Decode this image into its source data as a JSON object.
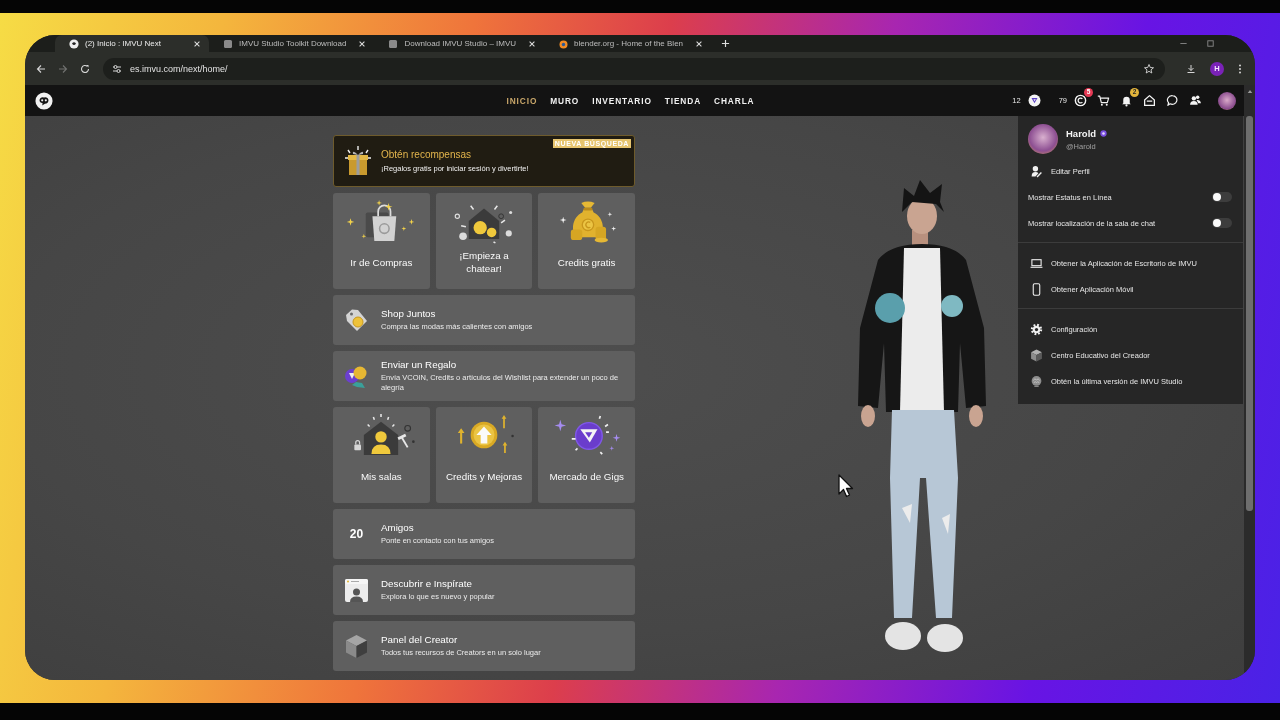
{
  "browser": {
    "tabs": [
      {
        "title": "(2) Inicio : IMVU Next",
        "selected": true
      },
      {
        "title": "IMVU Studio Toolkit Download",
        "selected": false
      },
      {
        "title": "Download IMVU Studio – IMVU",
        "selected": false
      },
      {
        "title": "blender.org - Home of the Blen",
        "selected": false
      }
    ],
    "forward_disabled": true,
    "url": "es.imvu.com/next/home/",
    "profile_initial": "H"
  },
  "nav": {
    "links": [
      {
        "label": "INICIO",
        "selected": true
      },
      {
        "label": "MURO",
        "selected": false
      },
      {
        "label": "INVENTARIO",
        "selected": false
      },
      {
        "label": "TIENDA",
        "selected": false
      },
      {
        "label": "CHARLA",
        "selected": false
      }
    ],
    "vcoin_balance": "12",
    "credits_balance": "79",
    "credits_badge": "5",
    "notifications_badge": "2"
  },
  "rewards_banner": {
    "badge": "NUEVA BÚSQUEDA",
    "title": "Obtén recompensas",
    "subtitle": "¡Regalos gratis por iniciar sesión y divertirte!"
  },
  "home_cards": [
    {
      "kind": "tiles",
      "tiles": [
        {
          "label": "Ir de Compras"
        },
        {
          "label": "¡Empieza a chatear!"
        },
        {
          "label": "Credits gratis"
        }
      ]
    },
    {
      "kind": "row",
      "title": "Shop Juntos",
      "subtitle": "Compra las modas más calientes con amigos"
    },
    {
      "kind": "row",
      "title": "Enviar un Regalo",
      "subtitle": "Envía VCOIN, Credits o artículos del Wishlist para extender un poco de alegría"
    },
    {
      "kind": "tiles",
      "tiles": [
        {
          "label": "Mis salas"
        },
        {
          "label": "Credits y Mejoras"
        },
        {
          "label": "Mercado de Gigs"
        }
      ]
    },
    {
      "kind": "row",
      "count": "20",
      "title": "Amigos",
      "subtitle": "Ponte en contacto con tus amigos"
    },
    {
      "kind": "row",
      "title": "Descubrir e Inspírate",
      "subtitle": "Explora lo que es nuevo y popular"
    },
    {
      "kind": "row",
      "title": "Panel del Creator",
      "subtitle": "Todos tus recursos de Creators en un solo lugar"
    }
  ],
  "account_menu": {
    "name": "Harold",
    "handle": "@Harold",
    "sections": [
      {
        "items": [
          {
            "kind": "link",
            "label": "Editar Perfil"
          },
          {
            "kind": "toggle",
            "label": "Mostrar Estatus en Línea",
            "on": false
          },
          {
            "kind": "toggle",
            "label": "Mostrar localización de la sala de chat",
            "on": false
          }
        ]
      },
      {
        "items": [
          {
            "kind": "link",
            "label": "Obtener la Aplicación de Escritorio de IMVU"
          },
          {
            "kind": "link",
            "label": "Obtener Aplicación Móvil"
          }
        ]
      },
      {
        "items": [
          {
            "kind": "link",
            "label": "Configuración"
          },
          {
            "kind": "link",
            "label": "Centro Educativo del Creador"
          },
          {
            "kind": "link",
            "label": "Obtén la última versión de IMVU Studio"
          }
        ]
      }
    ]
  }
}
